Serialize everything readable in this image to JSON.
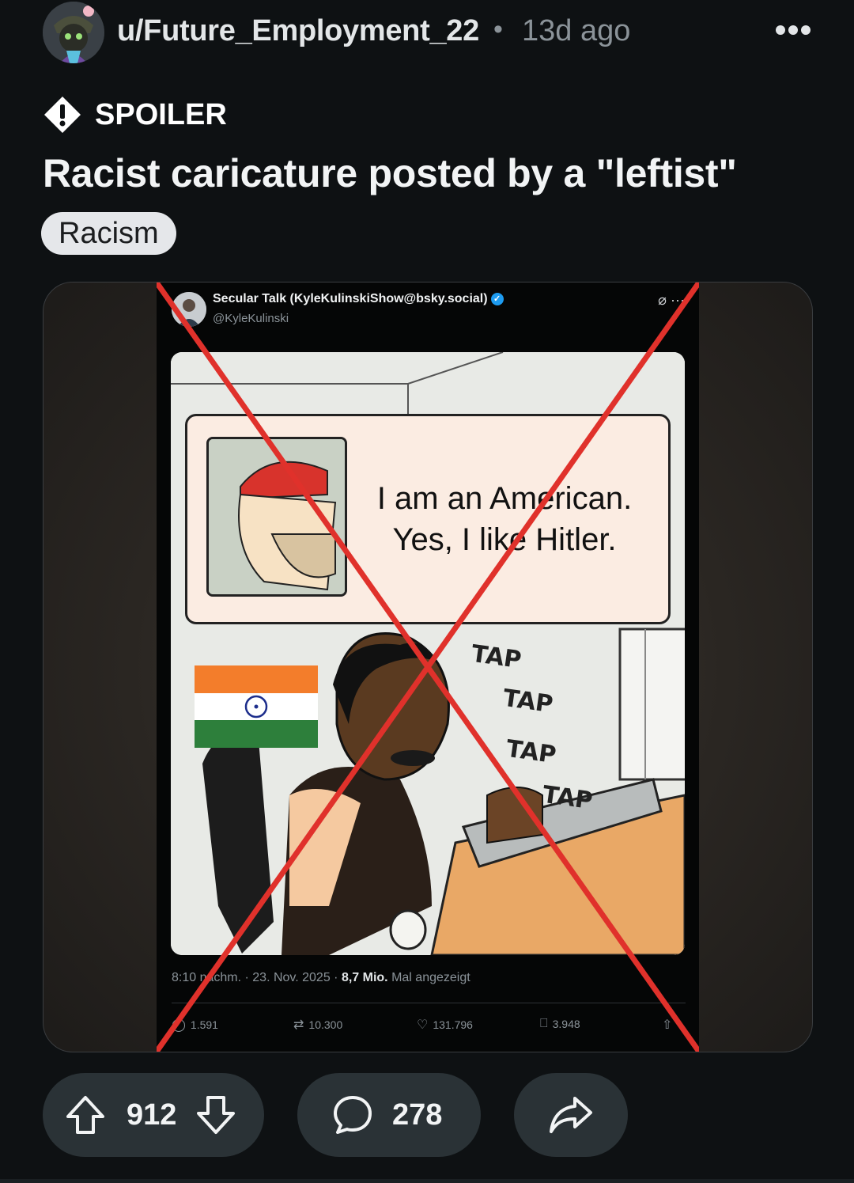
{
  "post": {
    "username": "u/Future_Employment_22",
    "separator": "•",
    "time_ago": "13d ago",
    "more_icon": "more-horizontal-icon",
    "spoiler_label": "SPOILER",
    "title": "Racist caricature posted by a \"leftist\"",
    "flair": "Racism"
  },
  "tweet": {
    "display_name": "Secular Talk (KyleKulinskiShow@bsky.social)",
    "handle": "@KyleKulinski",
    "speech_line1": "I am an American.",
    "speech_line2": "Yes, I like Hitler.",
    "tap1": "TAP",
    "tap2": "TAP",
    "tap3": "TAP",
    "tap4": "TAP",
    "meta_time": "8:10 nachm. · 23. Nov. 2025 · ",
    "meta_views": "8,7 Mio.",
    "meta_views_suffix": " Mal angezeigt",
    "replies": "1.591",
    "reposts": "10.300",
    "likes": "131.796",
    "bookmarks": "3.948"
  },
  "actions": {
    "upvotes": "912",
    "comments": "278"
  },
  "colors": {
    "background": "#0e1113",
    "pill": "#2a3236",
    "cross_out": "#e0312b",
    "flair_bg": "#e5e7ea"
  }
}
